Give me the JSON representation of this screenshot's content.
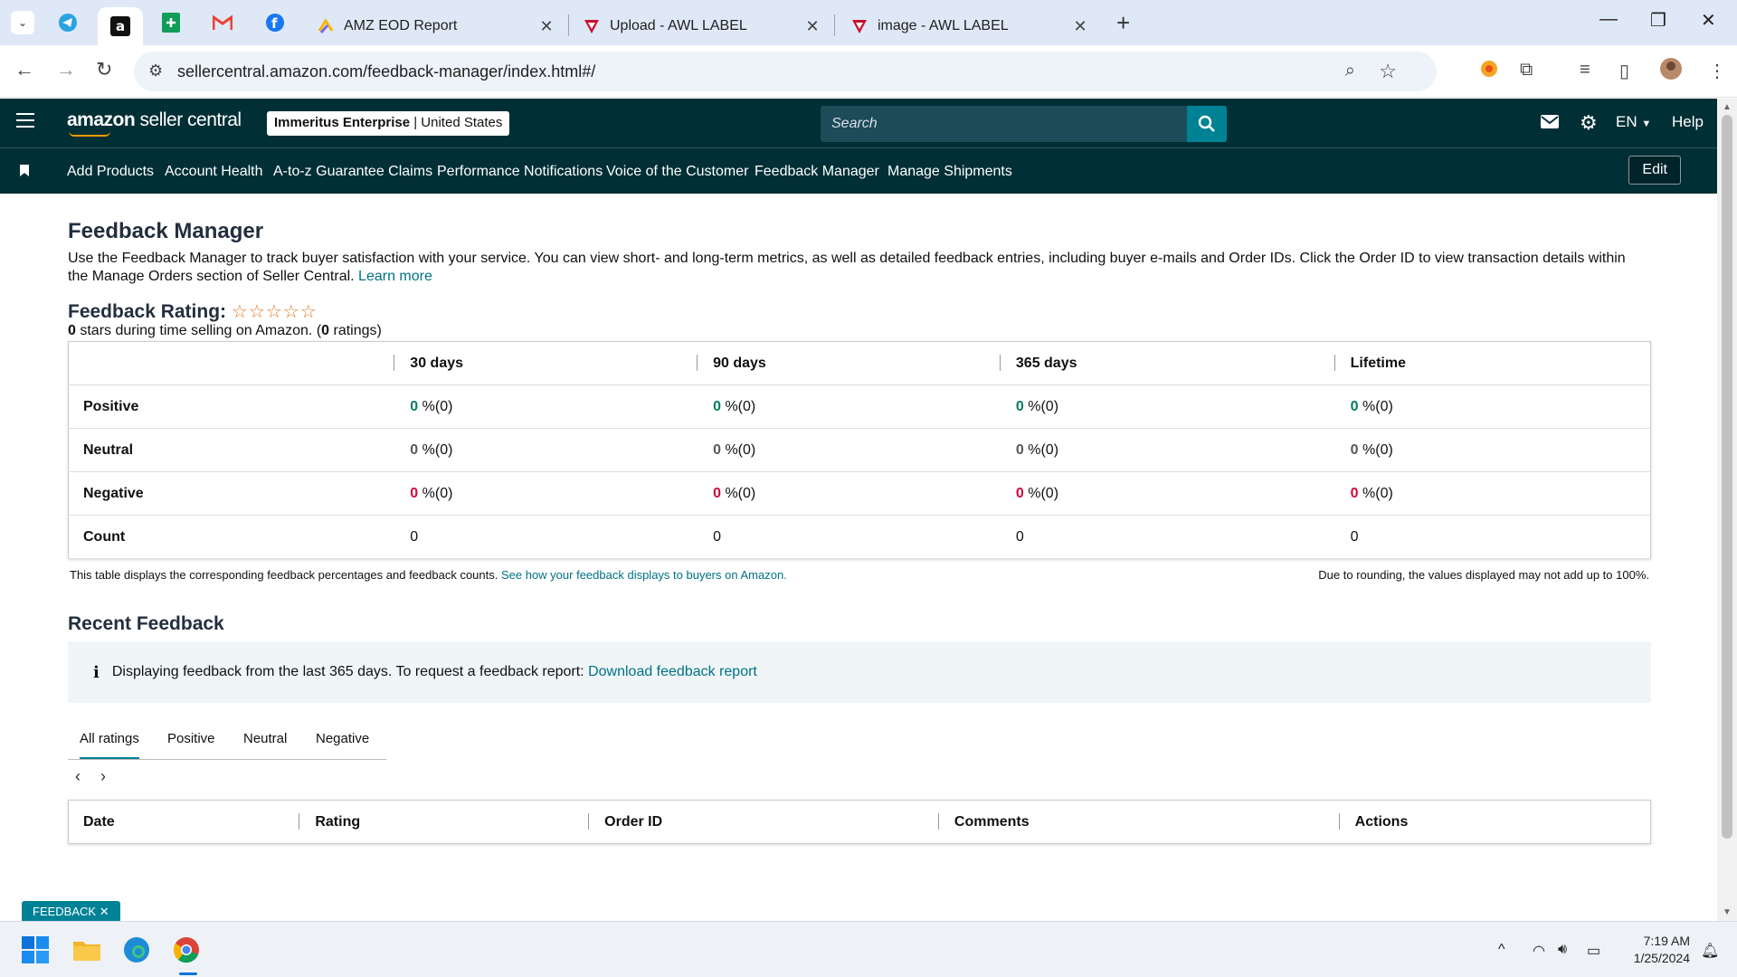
{
  "browser": {
    "tabs": [
      {
        "title": "AMZ EOD Report"
      },
      {
        "title": "Upload - AWL LABEL"
      },
      {
        "title": "image - AWL LABEL"
      }
    ],
    "url": "sellercentral.amazon.com/feedback-manager/index.html#/"
  },
  "header": {
    "logo_amazon": "amazon",
    "logo_rest": " seller central",
    "account_name": "Immeritus Enterprise",
    "account_sep": " | ",
    "account_region": "United States",
    "search_placeholder": "Search",
    "language": "EN",
    "help": "Help"
  },
  "nav": {
    "links": [
      "Add Products",
      "Account Health",
      "A-to-z Guarantee Claims",
      "Performance Notifications",
      "Voice of the Customer",
      "Feedback Manager",
      "Manage Shipments"
    ],
    "edit": "Edit"
  },
  "page": {
    "title": "Feedback Manager",
    "description": "Use the Feedback Manager to track buyer satisfaction with your service. You can view short- and long-term metrics, as well as detailed feedback entries, including buyer e-mails and Order IDs. Click the Order ID to view transaction details within the Manage Orders section of Seller Central. ",
    "learn_more": "Learn more",
    "rating_label": "Feedback Rating:",
    "stars": "☆☆☆☆☆",
    "stars_count": "0",
    "stars_text_1": " stars during time selling on Amazon. (",
    "ratings_count": "0",
    "stars_text_2": " ratings)"
  },
  "metrics": {
    "columns": [
      "30 days",
      "90 days",
      "365 days",
      "Lifetime"
    ],
    "rows": [
      {
        "label": "Positive",
        "values": [
          "0",
          "0",
          "0",
          "0"
        ],
        "counts": [
          "%(0)",
          "%(0)",
          "%(0)",
          "%(0)"
        ]
      },
      {
        "label": "Neutral",
        "values": [
          "0",
          "0",
          "0",
          "0"
        ],
        "counts": [
          "%(0)",
          "%(0)",
          "%(0)",
          "%(0)"
        ]
      },
      {
        "label": "Negative",
        "values": [
          "0",
          "0",
          "0",
          "0"
        ],
        "counts": [
          "%(0)",
          "%(0)",
          "%(0)",
          "%(0)"
        ]
      },
      {
        "label": "Count",
        "values": [
          "0",
          "0",
          "0",
          "0"
        ]
      }
    ],
    "footnote_left": "This table displays the corresponding feedback percentages and feedback counts. ",
    "footnote_link": "See how your feedback displays to buyers on Amazon.",
    "footnote_right": "Due to rounding, the values displayed may not add up to 100%."
  },
  "recent": {
    "title": "Recent Feedback",
    "info_text": "Displaying feedback from the last 365 days. To request a feedback report: ",
    "info_link": "Download feedback report",
    "tabs": [
      "All ratings",
      "Positive",
      "Neutral",
      "Negative"
    ],
    "columns": [
      "Date",
      "Rating",
      "Order ID",
      "Comments",
      "Actions"
    ]
  },
  "feedback_tag": "FEEDBACK",
  "taskbar": {
    "time": "7:19 AM",
    "date": "1/25/2024"
  },
  "colors": {
    "header_bg": "#002f36",
    "accent": "#008296",
    "positive": "#067d62",
    "negative": "#cc0c39",
    "star": "#de7921"
  }
}
